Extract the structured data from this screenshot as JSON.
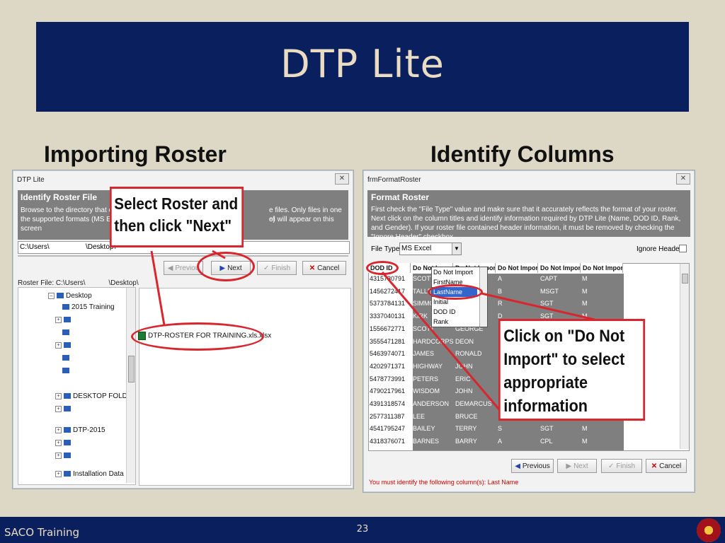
{
  "slide": {
    "title": "DTP Lite",
    "heading_left": "Importing Roster",
    "heading_right": "Identify Columns",
    "footer": "SACO Training",
    "page_number": "23"
  },
  "left_window": {
    "title": "DTP Lite",
    "info_title": "Identify Roster File",
    "info_text_1": "Browse to the directory that cont",
    "info_text_2": "e files.  Only files in one of",
    "info_text_3": "the supported formats (MS Excel",
    "info_text_4": "e) will appear on this",
    "info_text_5": "screen",
    "path_left": "C:\\Users\\",
    "path_right": "\\Desktop\\",
    "btn_previous": "Previou",
    "btn_next": "Next",
    "btn_finish": "Finish",
    "btn_cancel": "Cancel",
    "roster_file_label": "Roster File: C:\\Users\\",
    "roster_file_path": "\\Desktop\\",
    "tree": [
      "Desktop",
      "2015 Training",
      "DESKTOP FOLDI",
      "DTP-2015",
      "Installation Data"
    ],
    "file_name": "DTP-ROSTER FOR TRAINING.xls.xlsx"
  },
  "callout_left": "Select Roster and then click \"Next\"",
  "right_window": {
    "title": "frmFormatRoster",
    "info_title": "Format Roster",
    "info_text": "First check the \"File Type\" value and make sure that it accurately reflects the format of your roster.  Next click on the column titles and identify information required by DTP Lite (Name, DOD ID, Rank, and Gender).  If your roster file contained header information, it must be removed by checking the \"Ignore Header\" checkbox.",
    "file_type_label": "File Type",
    "file_type_value": "MS Excel",
    "ignore_header": "Ignore Header",
    "columns": [
      "DOD ID",
      "Do Not Import",
      "Do Not Import",
      "Do Not Import",
      "Do Not Import",
      "Do Not Import"
    ],
    "dropdown_options": [
      "Do Not Import",
      "FirstName",
      "LastName",
      "Initial",
      "DOD ID",
      "Rank"
    ],
    "rows": [
      [
        "4315730791",
        "SCOTT",
        "",
        "A",
        "CAPT",
        "M"
      ],
      [
        "1456272417",
        "TALLE",
        "",
        "B",
        "MSGT",
        "M"
      ],
      [
        "5373784131",
        "SIMMON",
        "",
        "R",
        "SGT",
        "M"
      ],
      [
        "3337040131",
        "KIRK",
        "",
        "D",
        "SGT",
        "M"
      ],
      [
        "1556672771",
        "SCOTT",
        "GEORGE",
        "",
        "",
        ""
      ],
      [
        "3555471281",
        "HARDCORPS",
        "DEON",
        "",
        "",
        ""
      ],
      [
        "5463974071",
        "JAMES",
        "RONALD",
        "",
        "",
        ""
      ],
      [
        "4202971371",
        "HIGHWAY",
        "JOHN",
        "",
        "",
        ""
      ],
      [
        "5478773991",
        "PETERS",
        "ERIC",
        "",
        "",
        ""
      ],
      [
        "4790217961",
        "WISDOM",
        "JOHN",
        "",
        "",
        ""
      ],
      [
        "4391318574",
        "ANDERSON",
        "DEMARCUS",
        "",
        "",
        ""
      ],
      [
        "2577311387",
        "LEE",
        "BRUCE",
        "",
        "",
        ""
      ],
      [
        "4541795247",
        "BAILEY",
        "TERRY",
        "S",
        "SGT",
        "M"
      ],
      [
        "4318376071",
        "BARNES",
        "BARRY",
        "A",
        "CPL",
        "M"
      ]
    ],
    "btn_previous": "Previous",
    "btn_next": "Next",
    "btn_finish": "Finish",
    "btn_cancel": "Cancel",
    "status": "You must identify the following column(s): Last Name"
  },
  "callout_right": "Click on \"Do Not Import\" to select appropriate information",
  "colors": {
    "banner": "#0a1f5e",
    "accent_red": "#d7262e",
    "grid": "#7f7f7f"
  }
}
